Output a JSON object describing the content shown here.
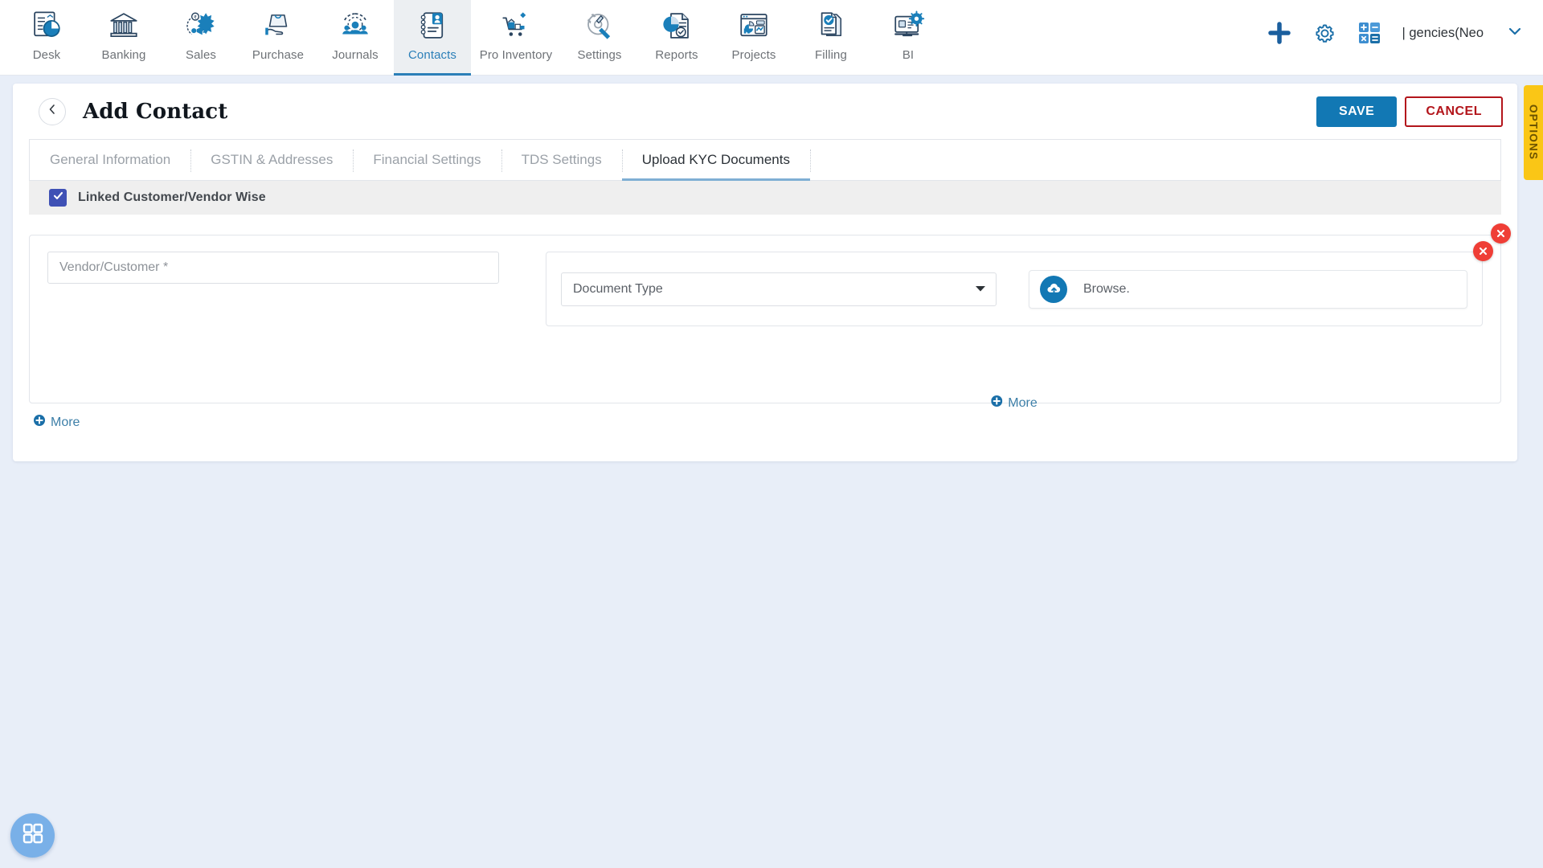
{
  "topnav": {
    "items": [
      {
        "label": "Desk",
        "icon": "desk-dashboard-icon",
        "active": false
      },
      {
        "label": "Banking",
        "icon": "bank-icon",
        "active": false
      },
      {
        "label": "Sales",
        "icon": "sales-megaphone-icon",
        "active": false
      },
      {
        "label": "Purchase",
        "icon": "purchase-bag-icon",
        "active": false
      },
      {
        "label": "Journals",
        "icon": "journals-gear-people-icon",
        "active": false
      },
      {
        "label": "Contacts",
        "icon": "contacts-book-icon",
        "active": true
      },
      {
        "label": "Pro Inventory",
        "icon": "inventory-cart-icon",
        "active": false
      },
      {
        "label": "Settings",
        "icon": "settings-tools-icon",
        "active": false
      },
      {
        "label": "Reports",
        "icon": "reports-piechart-icon",
        "active": false
      },
      {
        "label": "Projects",
        "icon": "projects-window-icon",
        "active": false
      },
      {
        "label": "Filling",
        "icon": "filling-docs-icon",
        "active": false
      },
      {
        "label": "BI",
        "icon": "bi-monitor-gear-icon",
        "active": false
      }
    ],
    "right": {
      "add_icon": "plus-icon",
      "settings_icon": "gear-icon",
      "calculator_icon": "calculator-icon",
      "company": "gencies(Neo |",
      "chevron_icon": "chevron-down-icon"
    }
  },
  "header": {
    "back_icon": "chevron-left-icon",
    "title": "Add Contact",
    "save_label": "SAVE",
    "cancel_label": "CANCEL"
  },
  "options_tab": {
    "label": "OPTIONS"
  },
  "tabs": [
    {
      "label": "General Information",
      "active": false
    },
    {
      "label": "GSTIN & Addresses",
      "active": false
    },
    {
      "label": "Financial Settings",
      "active": false
    },
    {
      "label": "TDS Settings",
      "active": false
    },
    {
      "label": "Upload KYC Documents",
      "active": true
    }
  ],
  "kyc": {
    "linked_checkbox": {
      "label": "Linked Customer/Vendor Wise",
      "checked": true,
      "icon": "checkmark-icon"
    },
    "vendor_customer": {
      "value": "",
      "placeholder": "Vendor/Customer *"
    },
    "document_type": {
      "selected": "Document Type",
      "options": [
        "Document Type"
      ],
      "arrow_icon": "caret-down-icon"
    },
    "browse": {
      "label": "Browse.",
      "icon": "cloud-upload-icon"
    },
    "remove_outer": {
      "icon": "close-x-icon"
    },
    "remove_inner": {
      "icon": "close-x-icon"
    },
    "more_inner": {
      "label": "More",
      "icon": "plus-circle-icon"
    },
    "more_outer": {
      "label": "More",
      "icon": "plus-circle-icon"
    }
  },
  "fab": {
    "icon": "apps-grid-icon"
  },
  "colors": {
    "accent_blue": "#1278b4",
    "danger_red": "#b3151b",
    "remove_red": "#ef3e36",
    "options_yellow": "#fac616",
    "checkbox_indigo": "#3f51b5",
    "page_bg": "#e8eef8"
  }
}
